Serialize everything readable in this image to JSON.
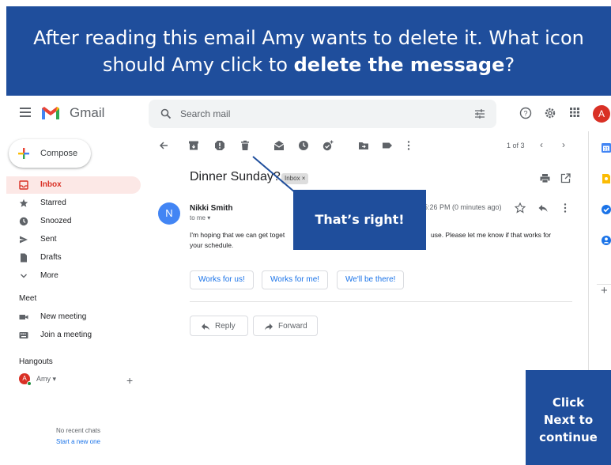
{
  "banner": {
    "question_prefix": "After reading this email Amy wants to delete it. What icon should Amy click to ",
    "question_bold": "delete the message",
    "question_suffix": "?"
  },
  "header": {
    "app_name": "Gmail",
    "search_placeholder": "Search mail",
    "avatar_letter": "A",
    "icons": [
      "menu-icon",
      "gmail-logo",
      "search-icon",
      "tune-icon",
      "help-icon",
      "settings-icon",
      "apps-icon"
    ]
  },
  "sidebar": {
    "compose_label": "Compose",
    "items": [
      {
        "label": "Inbox",
        "icon": "inbox-icon",
        "active": true
      },
      {
        "label": "Starred",
        "icon": "star-icon"
      },
      {
        "label": "Snoozed",
        "icon": "clock-icon"
      },
      {
        "label": "Sent",
        "icon": "send-icon"
      },
      {
        "label": "Drafts",
        "icon": "draft-icon"
      },
      {
        "label": "More",
        "icon": "chevron-down-icon"
      }
    ],
    "meet": {
      "title": "Meet",
      "items": [
        {
          "label": "New meeting",
          "icon": "video-icon"
        },
        {
          "label": "Join a meeting",
          "icon": "keyboard-icon"
        }
      ]
    },
    "hangouts": {
      "title": "Hangouts",
      "user_name": "Amy",
      "user_letter": "A",
      "no_chats": "No recent chats",
      "start_new": "Start a new one"
    }
  },
  "toolbar": {
    "icons": [
      "back-arrow-icon",
      "archive-icon",
      "report-spam-icon",
      "delete-icon",
      "mark-unread-icon",
      "snooze-icon",
      "add-to-tasks-icon",
      "move-to-icon",
      "label-icon",
      "more-vert-icon"
    ],
    "pager": "1 of 3"
  },
  "email": {
    "subject": "Dinner Sunday?",
    "label_chip": "Inbox ×",
    "sender_letter": "N",
    "sender_name": "Nikki Smith",
    "recipient": "to me ▾",
    "time": "5:26 PM (0 minutes ago)",
    "body_line1_start": "I'm hoping that we can get toget",
    "body_line1_end": "use. Please let me know if that works for",
    "body_line2": "your schedule.",
    "smart_replies": [
      "Works for us!",
      "Works for me!",
      "We'll be there!"
    ],
    "reply_label": "Reply",
    "forward_label": "Forward"
  },
  "right_panel": {
    "icons": [
      "calendar-icon",
      "keep-icon",
      "tasks-icon",
      "contacts-icon",
      "add-icon"
    ]
  },
  "feedback": {
    "text": "That’s right!"
  },
  "next": {
    "line1": "Click",
    "line2": "Next to",
    "line3": "continue"
  },
  "colors": {
    "banner": "#1f4e9c",
    "gmail_red": "#d93025",
    "link_blue": "#1a73e8"
  }
}
